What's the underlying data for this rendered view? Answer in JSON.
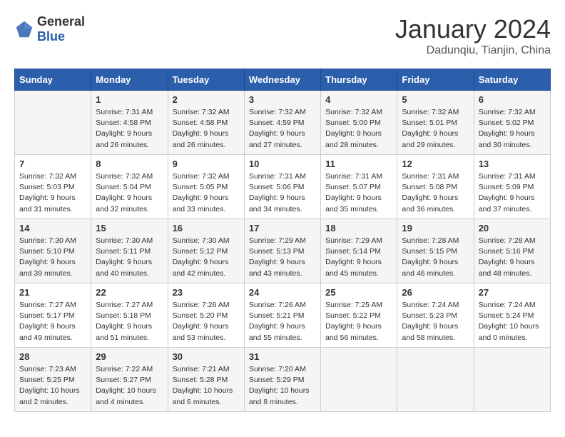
{
  "header": {
    "logo_general": "General",
    "logo_blue": "Blue",
    "title": "January 2024",
    "location": "Dadunqiu, Tianjin, China"
  },
  "weekdays": [
    "Sunday",
    "Monday",
    "Tuesday",
    "Wednesday",
    "Thursday",
    "Friday",
    "Saturday"
  ],
  "weeks": [
    [
      {
        "day": "",
        "lines": []
      },
      {
        "day": "1",
        "lines": [
          "Sunrise: 7:31 AM",
          "Sunset: 4:58 PM",
          "Daylight: 9 hours",
          "and 26 minutes."
        ]
      },
      {
        "day": "2",
        "lines": [
          "Sunrise: 7:32 AM",
          "Sunset: 4:58 PM",
          "Daylight: 9 hours",
          "and 26 minutes."
        ]
      },
      {
        "day": "3",
        "lines": [
          "Sunrise: 7:32 AM",
          "Sunset: 4:59 PM",
          "Daylight: 9 hours",
          "and 27 minutes."
        ]
      },
      {
        "day": "4",
        "lines": [
          "Sunrise: 7:32 AM",
          "Sunset: 5:00 PM",
          "Daylight: 9 hours",
          "and 28 minutes."
        ]
      },
      {
        "day": "5",
        "lines": [
          "Sunrise: 7:32 AM",
          "Sunset: 5:01 PM",
          "Daylight: 9 hours",
          "and 29 minutes."
        ]
      },
      {
        "day": "6",
        "lines": [
          "Sunrise: 7:32 AM",
          "Sunset: 5:02 PM",
          "Daylight: 9 hours",
          "and 30 minutes."
        ]
      }
    ],
    [
      {
        "day": "7",
        "lines": [
          "Sunrise: 7:32 AM",
          "Sunset: 5:03 PM",
          "Daylight: 9 hours",
          "and 31 minutes."
        ]
      },
      {
        "day": "8",
        "lines": [
          "Sunrise: 7:32 AM",
          "Sunset: 5:04 PM",
          "Daylight: 9 hours",
          "and 32 minutes."
        ]
      },
      {
        "day": "9",
        "lines": [
          "Sunrise: 7:32 AM",
          "Sunset: 5:05 PM",
          "Daylight: 9 hours",
          "and 33 minutes."
        ]
      },
      {
        "day": "10",
        "lines": [
          "Sunrise: 7:31 AM",
          "Sunset: 5:06 PM",
          "Daylight: 9 hours",
          "and 34 minutes."
        ]
      },
      {
        "day": "11",
        "lines": [
          "Sunrise: 7:31 AM",
          "Sunset: 5:07 PM",
          "Daylight: 9 hours",
          "and 35 minutes."
        ]
      },
      {
        "day": "12",
        "lines": [
          "Sunrise: 7:31 AM",
          "Sunset: 5:08 PM",
          "Daylight: 9 hours",
          "and 36 minutes."
        ]
      },
      {
        "day": "13",
        "lines": [
          "Sunrise: 7:31 AM",
          "Sunset: 5:09 PM",
          "Daylight: 9 hours",
          "and 37 minutes."
        ]
      }
    ],
    [
      {
        "day": "14",
        "lines": [
          "Sunrise: 7:30 AM",
          "Sunset: 5:10 PM",
          "Daylight: 9 hours",
          "and 39 minutes."
        ]
      },
      {
        "day": "15",
        "lines": [
          "Sunrise: 7:30 AM",
          "Sunset: 5:11 PM",
          "Daylight: 9 hours",
          "and 40 minutes."
        ]
      },
      {
        "day": "16",
        "lines": [
          "Sunrise: 7:30 AM",
          "Sunset: 5:12 PM",
          "Daylight: 9 hours",
          "and 42 minutes."
        ]
      },
      {
        "day": "17",
        "lines": [
          "Sunrise: 7:29 AM",
          "Sunset: 5:13 PM",
          "Daylight: 9 hours",
          "and 43 minutes."
        ]
      },
      {
        "day": "18",
        "lines": [
          "Sunrise: 7:29 AM",
          "Sunset: 5:14 PM",
          "Daylight: 9 hours",
          "and 45 minutes."
        ]
      },
      {
        "day": "19",
        "lines": [
          "Sunrise: 7:28 AM",
          "Sunset: 5:15 PM",
          "Daylight: 9 hours",
          "and 46 minutes."
        ]
      },
      {
        "day": "20",
        "lines": [
          "Sunrise: 7:28 AM",
          "Sunset: 5:16 PM",
          "Daylight: 9 hours",
          "and 48 minutes."
        ]
      }
    ],
    [
      {
        "day": "21",
        "lines": [
          "Sunrise: 7:27 AM",
          "Sunset: 5:17 PM",
          "Daylight: 9 hours",
          "and 49 minutes."
        ]
      },
      {
        "day": "22",
        "lines": [
          "Sunrise: 7:27 AM",
          "Sunset: 5:18 PM",
          "Daylight: 9 hours",
          "and 51 minutes."
        ]
      },
      {
        "day": "23",
        "lines": [
          "Sunrise: 7:26 AM",
          "Sunset: 5:20 PM",
          "Daylight: 9 hours",
          "and 53 minutes."
        ]
      },
      {
        "day": "24",
        "lines": [
          "Sunrise: 7:26 AM",
          "Sunset: 5:21 PM",
          "Daylight: 9 hours",
          "and 55 minutes."
        ]
      },
      {
        "day": "25",
        "lines": [
          "Sunrise: 7:25 AM",
          "Sunset: 5:22 PM",
          "Daylight: 9 hours",
          "and 56 minutes."
        ]
      },
      {
        "day": "26",
        "lines": [
          "Sunrise: 7:24 AM",
          "Sunset: 5:23 PM",
          "Daylight: 9 hours",
          "and 58 minutes."
        ]
      },
      {
        "day": "27",
        "lines": [
          "Sunrise: 7:24 AM",
          "Sunset: 5:24 PM",
          "Daylight: 10 hours",
          "and 0 minutes."
        ]
      }
    ],
    [
      {
        "day": "28",
        "lines": [
          "Sunrise: 7:23 AM",
          "Sunset: 5:25 PM",
          "Daylight: 10 hours",
          "and 2 minutes."
        ]
      },
      {
        "day": "29",
        "lines": [
          "Sunrise: 7:22 AM",
          "Sunset: 5:27 PM",
          "Daylight: 10 hours",
          "and 4 minutes."
        ]
      },
      {
        "day": "30",
        "lines": [
          "Sunrise: 7:21 AM",
          "Sunset: 5:28 PM",
          "Daylight: 10 hours",
          "and 6 minutes."
        ]
      },
      {
        "day": "31",
        "lines": [
          "Sunrise: 7:20 AM",
          "Sunset: 5:29 PM",
          "Daylight: 10 hours",
          "and 8 minutes."
        ]
      },
      {
        "day": "",
        "lines": []
      },
      {
        "day": "",
        "lines": []
      },
      {
        "day": "",
        "lines": []
      }
    ]
  ]
}
